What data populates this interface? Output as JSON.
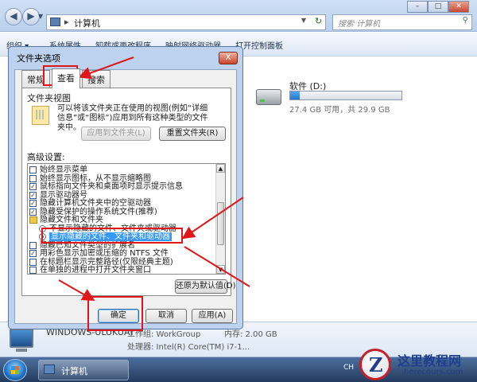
{
  "explorer": {
    "breadcrumb": "计算机",
    "search_placeholder": "搜索 计算机",
    "toolbar": [
      "组织 ▾",
      "系统属性",
      "卸载或更改程序",
      "映射网络驱动器",
      "打开控制面板"
    ],
    "drive": {
      "name": "软件 (D:)",
      "free_text": "27.4 GB 可用，共 29.9 GB",
      "used_fraction": 0.084
    },
    "details": {
      "name": "WINDOWS-ULUKUAT",
      "workgroup": "工作组: WorkGroup",
      "memory": "内存: 2.00 GB",
      "processor": "处理器: Intel(R) Core(TM) i7-1..."
    }
  },
  "taskbar": {
    "item_label": "计算机",
    "lang": "CH"
  },
  "dialog": {
    "title": "文件夹选项",
    "close_label": "X",
    "tabs": [
      "常规",
      "查看",
      "搜索"
    ],
    "folder_views": {
      "title": "文件夹视图",
      "description": "可以将该文件夹正在使用的视图(例如“详细信息”或“图标”)应用到所有这种类型的文件夹中。",
      "apply_button": "应用到文件夹(L)",
      "reset_button": "重置文件夹(R)"
    },
    "advanced": {
      "label": "高级设置:",
      "items": [
        {
          "kind": "check",
          "checked": false,
          "text": "始终显示菜单"
        },
        {
          "kind": "check",
          "checked": false,
          "text": "始终显示图标，从不显示缩略图"
        },
        {
          "kind": "check",
          "checked": true,
          "text": "鼠标指向文件夹和桌面项时显示提示信息"
        },
        {
          "kind": "check",
          "checked": true,
          "text": "显示驱动器号"
        },
        {
          "kind": "check",
          "checked": true,
          "text": "隐藏计算机文件夹中的空驱动器"
        },
        {
          "kind": "check",
          "checked": true,
          "text": "隐藏受保护的操作系统文件(推荐)"
        },
        {
          "kind": "folder",
          "text": "隐藏文件和文件夹"
        },
        {
          "kind": "radio",
          "checked": false,
          "text": "不显示隐藏的文件、文件夹或驱动器"
        },
        {
          "kind": "radio",
          "checked": true,
          "text": "显示隐藏的文件、文件夹和驱动器",
          "selected": true
        },
        {
          "kind": "check",
          "checked": false,
          "text": "隐藏已知文件类型的扩展名"
        },
        {
          "kind": "check",
          "checked": true,
          "text": "用彩色显示加密或压缩的 NTFS 文件"
        },
        {
          "kind": "check",
          "checked": false,
          "text": "在标题栏显示完整路径(仅限经典主题)"
        },
        {
          "kind": "check",
          "checked": false,
          "text": "在单独的进程中打开文件夹窗口"
        }
      ]
    },
    "restore_button": "还原为默认值(D)",
    "ok_button": "确定",
    "cancel_button": "取消",
    "apply_button": "应用(A)"
  },
  "watermark": {
    "logo_letter": "Z",
    "title": "这里教程网",
    "url": "herecours.com"
  },
  "colors": {
    "annotation": "#e0161b",
    "selection": "#3399ff"
  }
}
